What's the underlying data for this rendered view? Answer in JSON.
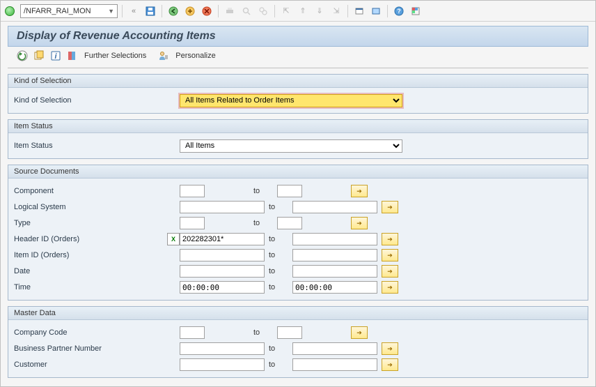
{
  "toolbar": {
    "tcode": "/NFARR_RAI_MON"
  },
  "title": "Display of Revenue Accounting Items",
  "actions": {
    "further_selections": "Further Selections",
    "personalize": "Personalize"
  },
  "to_label": "to",
  "groups": {
    "kind": {
      "title": "Kind of Selection",
      "label": "Kind of Selection",
      "value": "All Items Related to Order Items"
    },
    "status": {
      "title": "Item Status",
      "label": "Item Status",
      "value": "All Items"
    },
    "source": {
      "title": "Source Documents",
      "fields": [
        {
          "label": "Component",
          "from": "",
          "to": ""
        },
        {
          "label": "Logical System",
          "from": "",
          "to": ""
        },
        {
          "label": "Type",
          "from": "",
          "to": ""
        },
        {
          "label": "Header ID (Orders)",
          "from": "202282301*",
          "to": "",
          "excel": true
        },
        {
          "label": "Item ID (Orders)",
          "from": "",
          "to": ""
        },
        {
          "label": "Date",
          "from": "",
          "to": ""
        },
        {
          "label": "Time",
          "from": "00:00:00",
          "to": "00:00:00"
        }
      ]
    },
    "master": {
      "title": "Master Data",
      "fields": [
        {
          "label": "Company Code",
          "from": "",
          "to": ""
        },
        {
          "label": "Business Partner Number",
          "from": "",
          "to": ""
        },
        {
          "label": "Customer",
          "from": "",
          "to": ""
        }
      ]
    }
  }
}
